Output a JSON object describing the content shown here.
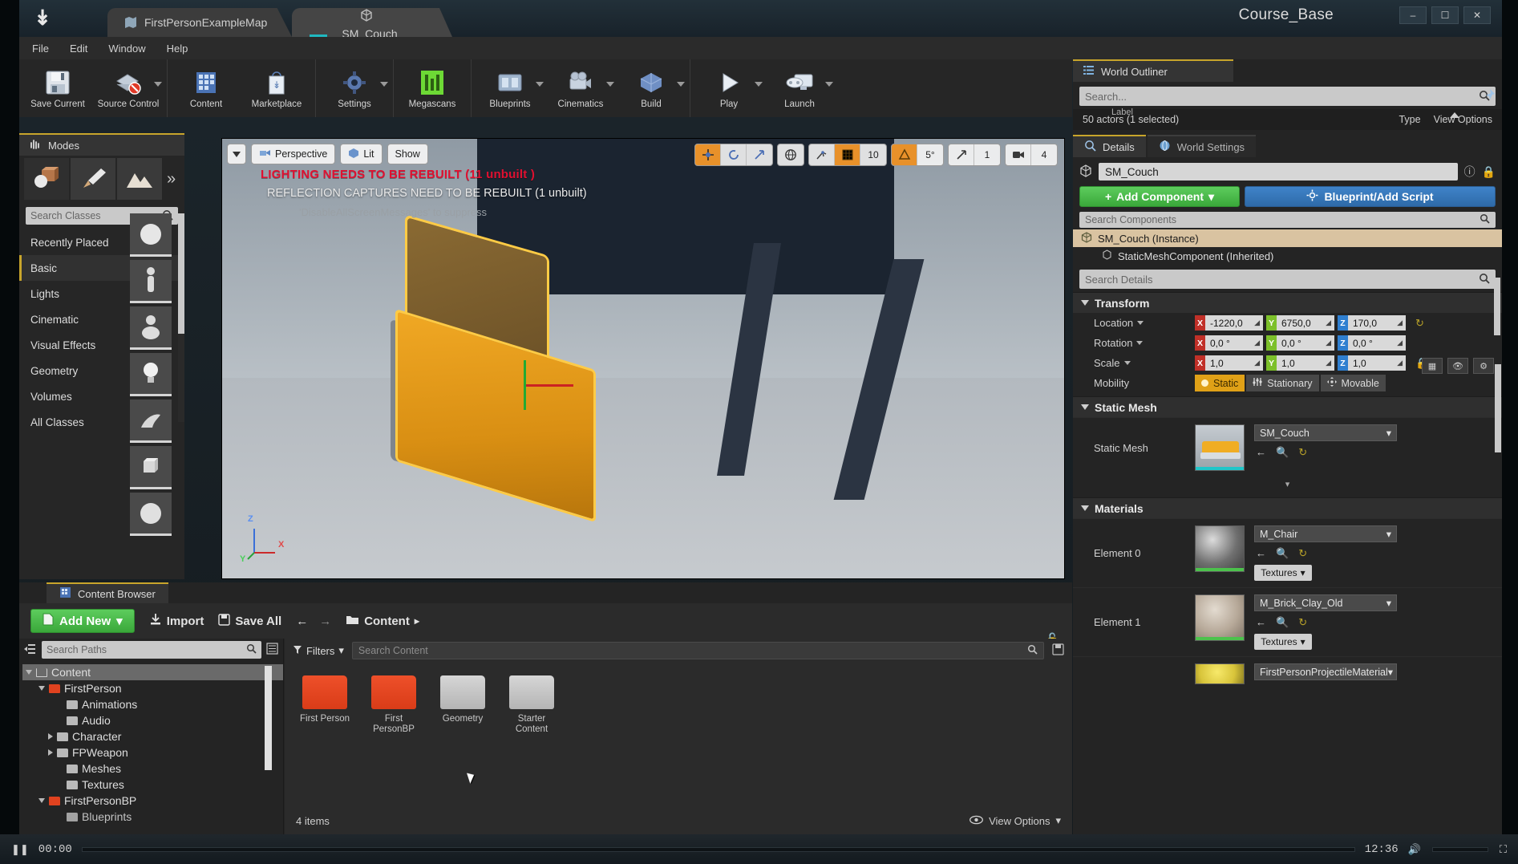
{
  "window": {
    "project_name": "Course_Base",
    "tabs": [
      {
        "label": "FirstPersonExampleMap",
        "icon": "map-icon",
        "active": false
      },
      {
        "label": "SM_Couch",
        "icon": "mesh-icon",
        "active": true
      }
    ],
    "buttons": {
      "minimize": "–",
      "maximize": "☐",
      "close": "✕"
    }
  },
  "menubar": {
    "items": [
      "File",
      "Edit",
      "Window",
      "Help"
    ]
  },
  "toolbar": {
    "groups": [
      {
        "items": [
          {
            "label": "Save Current",
            "icon": "save-icon",
            "caret": false
          },
          {
            "label": "Source Control",
            "icon": "source-control-icon",
            "caret": true
          }
        ]
      },
      {
        "items": [
          {
            "label": "Content",
            "icon": "content-icon",
            "caret": false
          },
          {
            "label": "Marketplace",
            "icon": "marketplace-icon",
            "caret": false
          }
        ]
      },
      {
        "items": [
          {
            "label": "Settings",
            "icon": "settings-icon",
            "caret": true
          }
        ]
      },
      {
        "items": [
          {
            "label": "Megascans",
            "icon": "megascans-icon",
            "caret": false
          }
        ]
      },
      {
        "items": [
          {
            "label": "Blueprints",
            "icon": "blueprints-icon",
            "caret": true
          },
          {
            "label": "Cinematics",
            "icon": "cinematics-icon",
            "caret": true
          },
          {
            "label": "Build",
            "icon": "build-icon",
            "caret": true
          }
        ]
      },
      {
        "items": [
          {
            "label": "Play",
            "icon": "play-icon",
            "caret": true
          },
          {
            "label": "Launch",
            "icon": "launch-icon",
            "caret": true
          }
        ]
      }
    ]
  },
  "modes": {
    "tab_label": "Modes",
    "mode_icons": [
      "place-mode-icon",
      "paint-mode-icon",
      "landscape-mode-icon"
    ],
    "more_label": "»",
    "search_placeholder": "Search Classes",
    "categories": [
      {
        "label": "Recently Placed",
        "active": false
      },
      {
        "label": "Basic",
        "active": true
      },
      {
        "label": "Lights",
        "active": false
      },
      {
        "label": "Cinematic",
        "active": false
      },
      {
        "label": "Visual Effects",
        "active": false
      },
      {
        "label": "Geometry",
        "active": false
      },
      {
        "label": "Volumes",
        "active": false
      },
      {
        "label": "All Classes",
        "active": false
      }
    ],
    "place_items": [
      "sphere-thumb",
      "player-start-thumb",
      "shapes-thumb",
      "point-light-thumb",
      "dragon-thumb",
      "cube-thumb",
      "sphere2-thumb"
    ]
  },
  "viewport": {
    "perspective_label": "Perspective",
    "lit_label": "Lit",
    "show_label": "Show",
    "messages": {
      "lighting": "LIGHTING NEEDS TO BE REBUILT (11 unbuilt )",
      "reflection": "REFLECTION CAPTURES NEED TO BE REBUILT (1 unbuilt)",
      "suppress": "'DisableAllScreenMessages' to suppress"
    },
    "tools": {
      "translate": "translate-gizmo-icon",
      "rotate": "rotate-gizmo-icon",
      "scale": "scale-gizmo-icon",
      "world_space": "world-space-icon",
      "surface_snap": "surface-snap-icon",
      "grid_snap": "grid-snap-icon",
      "grid_value": "10",
      "angle_snap": "angle-snap-icon",
      "angle_value": "5°",
      "scale_snap": "scale-snap-icon",
      "scale_value": "1",
      "camera_speed": "camera-speed-icon",
      "camera_value": "4"
    },
    "axis": {
      "x": "X",
      "y": "Y",
      "z": "Z"
    }
  },
  "world_outliner": {
    "tab_label": "World Outliner",
    "search_placeholder": "Search...",
    "column_label": "Label",
    "column_type": "Type",
    "actor_count": "50 actors (1 selected)",
    "view_options": "View Options"
  },
  "details": {
    "tab_label": "Details",
    "world_settings_tab": "World Settings",
    "actor_name": "SM_Couch",
    "add_component_label": "Add Component",
    "blueprint_label": "Blueprint/Add Script",
    "component_search_placeholder": "Search Components",
    "components": [
      {
        "label": "SM_Couch (Instance)",
        "selected": true,
        "child": false
      },
      {
        "label": "StaticMeshComponent (Inherited)",
        "selected": false,
        "child": true
      }
    ],
    "details_search_placeholder": "Search Details",
    "transform": {
      "title": "Transform",
      "rows": [
        {
          "label": "Location",
          "x": "-1220,0",
          "y": "6750,0",
          "z": "170,0"
        },
        {
          "label": "Rotation",
          "x": "0,0 °",
          "y": "0,0 °",
          "z": "0,0 °"
        },
        {
          "label": "Scale",
          "x": "1,0",
          "y": "1,0",
          "z": "1,0"
        }
      ],
      "mobility_label": "Mobility",
      "mobility": [
        {
          "label": "Static",
          "active": true
        },
        {
          "label": "Stationary",
          "active": false
        },
        {
          "label": "Movable",
          "active": false
        }
      ]
    },
    "static_mesh": {
      "title": "Static Mesh",
      "row_label": "Static Mesh",
      "value": "SM_Couch"
    },
    "materials": {
      "title": "Materials",
      "textures_label": "Textures",
      "elements": [
        {
          "label": "Element 0",
          "value": "M_Chair"
        },
        {
          "label": "Element 1",
          "value": "M_Brick_Clay_Old"
        },
        {
          "label": "",
          "value": "FirstPersonProjectileMaterial"
        }
      ]
    }
  },
  "content_browser": {
    "tab_label": "Content Browser",
    "add_new_label": "Add New",
    "import_label": "Import",
    "save_all_label": "Save All",
    "breadcrumb": "Content",
    "paths_search_placeholder": "Search Paths",
    "filters_label": "Filters",
    "content_search_placeholder": "Search Content",
    "tree": [
      {
        "label": "Content",
        "depth": 0,
        "state": "open",
        "selected": true,
        "folder": "open"
      },
      {
        "label": "FirstPerson",
        "depth": 1,
        "state": "open",
        "selected": false,
        "folder": "red"
      },
      {
        "label": "Animations",
        "depth": 2,
        "state": "none",
        "selected": false,
        "folder": "gray"
      },
      {
        "label": "Audio",
        "depth": 2,
        "state": "none",
        "selected": false,
        "folder": "gray"
      },
      {
        "label": "Character",
        "depth": 2,
        "state": "closed",
        "selected": false,
        "folder": "gray"
      },
      {
        "label": "FPWeapon",
        "depth": 2,
        "state": "closed",
        "selected": false,
        "folder": "gray"
      },
      {
        "label": "Meshes",
        "depth": 2,
        "state": "none",
        "selected": false,
        "folder": "gray"
      },
      {
        "label": "Textures",
        "depth": 2,
        "state": "none",
        "selected": false,
        "folder": "gray"
      },
      {
        "label": "FirstPersonBP",
        "depth": 1,
        "state": "open",
        "selected": false,
        "folder": "red"
      },
      {
        "label": "Blueprints",
        "depth": 2,
        "state": "none",
        "selected": false,
        "folder": "gray"
      }
    ],
    "assets": [
      {
        "name": "First Person",
        "color": "red"
      },
      {
        "name": "First PersonBP",
        "color": "red"
      },
      {
        "name": "Geometry",
        "color": "gray"
      },
      {
        "name": "Starter Content",
        "color": "gray"
      }
    ],
    "item_count": "4 items",
    "view_options": "View Options"
  },
  "statusbar": {
    "time_current": "00:00",
    "time_total": "12:36"
  },
  "colors": {
    "accent_green": "#3aa83a",
    "accent_blue": "#2e6aa8",
    "warning_red": "#e01030",
    "highlight_orange": "#e0a117",
    "axis_x": "#c03028",
    "axis_y": "#7cc02a",
    "axis_z": "#2f7fd0"
  }
}
